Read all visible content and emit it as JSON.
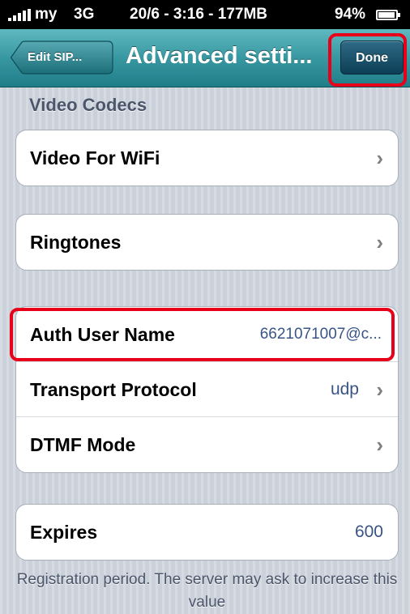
{
  "status_bar": {
    "carrier": "my",
    "network": "3G",
    "clock": "20/6 - 3:16 - 177MB",
    "battery": "94%"
  },
  "nav": {
    "back_label": "Edit SIP...",
    "title": "Advanced setti...",
    "done_label": "Done"
  },
  "video_section": {
    "header": "Video Codecs",
    "video_wifi_label": "Video For WiFi"
  },
  "ringtones_label": "Ringtones",
  "account": {
    "auth_user_label": "Auth User Name",
    "auth_user_value": "6621071007@c...",
    "transport_label": "Transport Protocol",
    "transport_value": "udp",
    "dtmf_label": "DTMF Mode"
  },
  "expires": {
    "label": "Expires",
    "value": "600",
    "footer": "Registration period. The server may ask to increase this value"
  },
  "colors": {
    "nav_bar": "#3898a2",
    "done_button": "#0d3e56",
    "highlight": "#e8001a",
    "value_text": "#385487"
  },
  "icons": {
    "chevron": "chevron-right-icon",
    "signal": "signal-bars-icon",
    "battery": "battery-icon",
    "back": "back-arrow-icon"
  }
}
